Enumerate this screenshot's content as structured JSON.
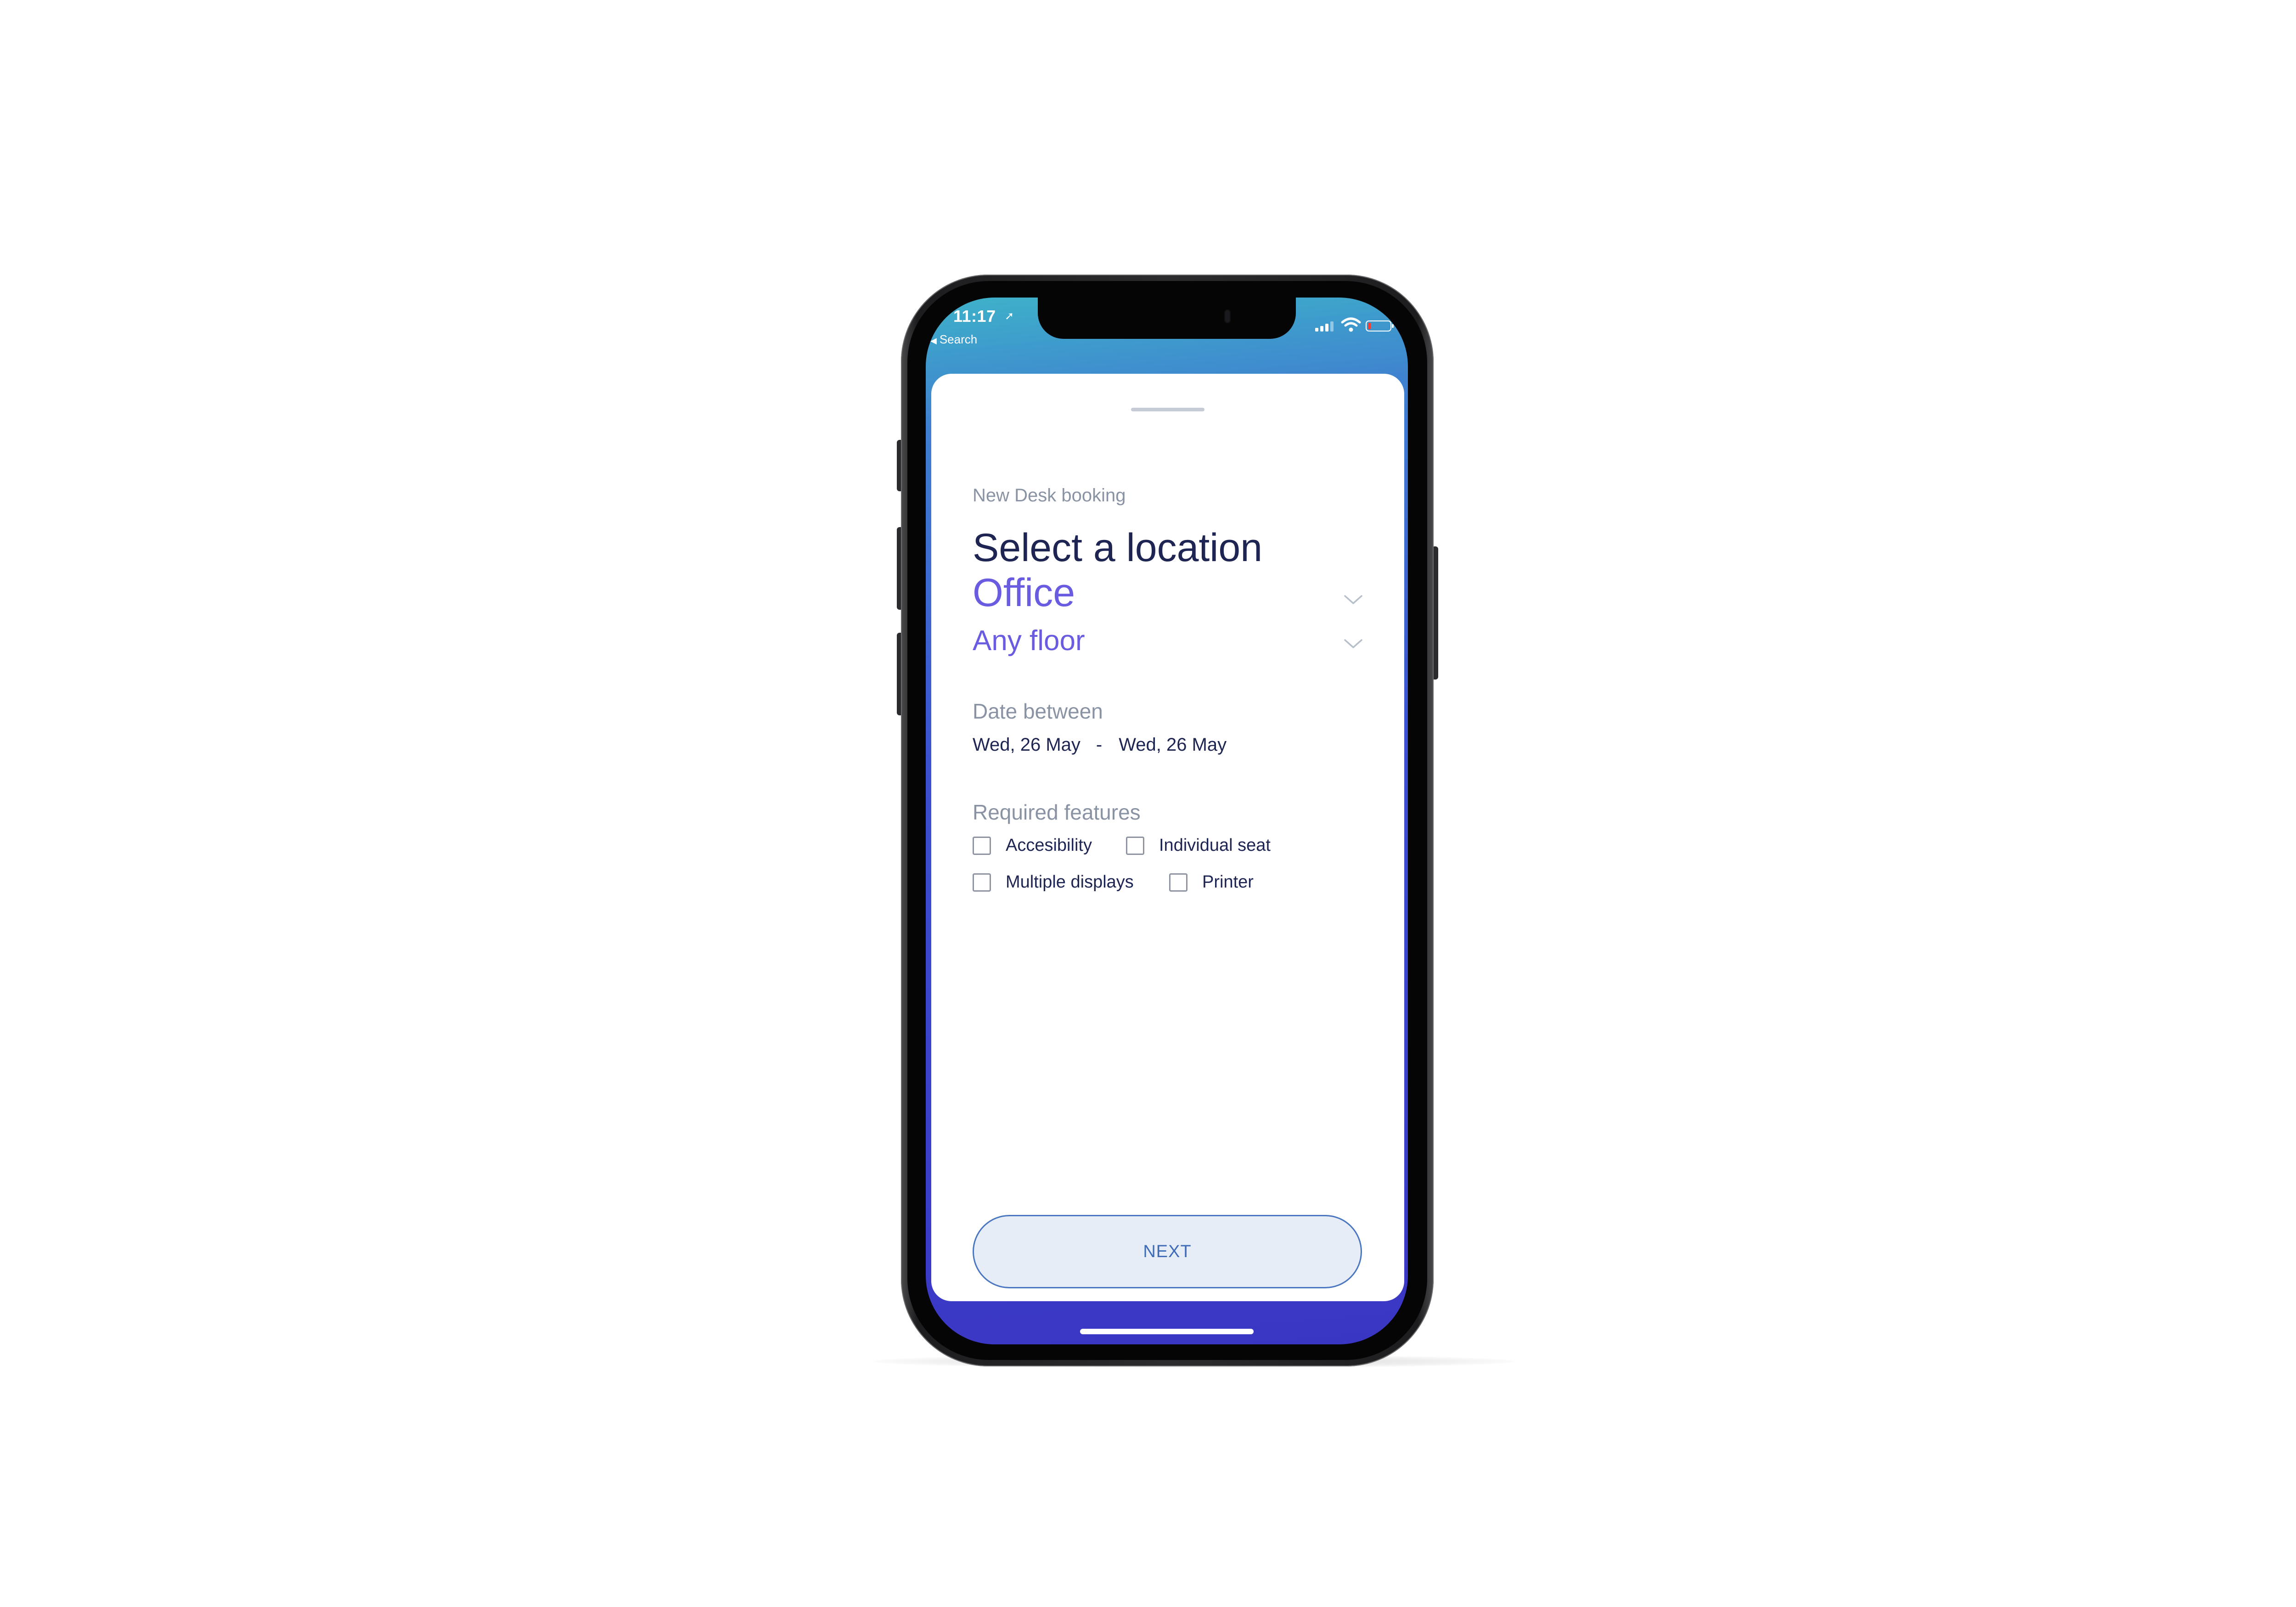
{
  "status_bar": {
    "time": "11:17",
    "back_label": "Search"
  },
  "booking": {
    "eyebrow": "New Desk booking",
    "title": "Select a location",
    "location_value": "Office",
    "floor_value": "Any floor",
    "date_label": "Date between",
    "date_from": "Wed, 26 May",
    "date_separator": "-",
    "date_to": "Wed, 26 May",
    "features_label": "Required features",
    "features": [
      {
        "label": "Accesibility",
        "checked": false
      },
      {
        "label": "Individual seat",
        "checked": false
      },
      {
        "label": "Multiple displays",
        "checked": false
      },
      {
        "label": "Printer",
        "checked": false
      }
    ],
    "next_label": "NEXT"
  },
  "colors": {
    "title": "#1e2553",
    "accent_purple": "#6a5ce0",
    "muted_label": "#8a93a3",
    "button_border": "#4a76c0",
    "button_fill": "#e6edf6",
    "gradient_top": "#3eb2c9",
    "gradient_bottom": "#3a36c4"
  },
  "icons": {
    "status": [
      "location-arrow-icon",
      "signal-icon",
      "wifi-icon",
      "battery-icon"
    ],
    "dropdown": "chevron-down-icon"
  }
}
